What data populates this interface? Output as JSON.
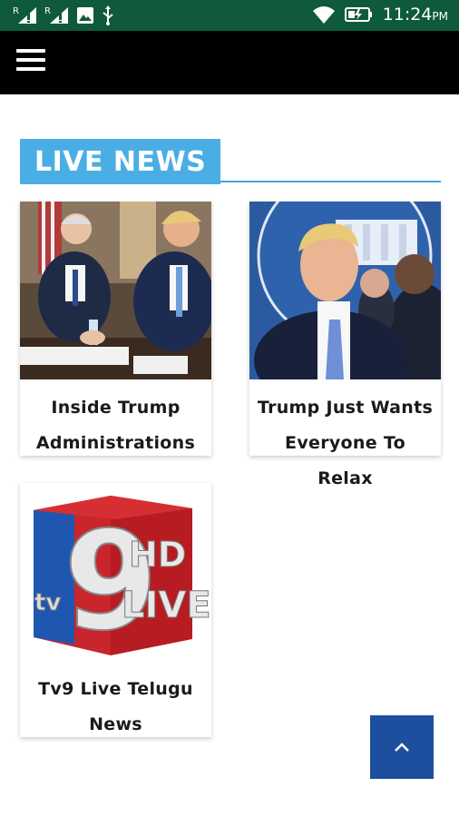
{
  "status_bar": {
    "sim1_label": "R",
    "sim2_label": "R",
    "time": "11:24",
    "ampm": "PM",
    "background_color": "#0f5a3c",
    "icons": [
      "signal-icon",
      "signal-icon",
      "image-icon",
      "usb-icon",
      "wifi-icon",
      "battery-charging-icon"
    ]
  },
  "app_bar": {
    "menu_icon": "hamburger-menu-icon",
    "background_color": "#000000"
  },
  "section": {
    "title": "LIVE NEWS",
    "accent_color": "#4aaee4"
  },
  "cards": [
    {
      "title": "Inside Trump Administrations",
      "image": "meeting-photo"
    },
    {
      "title": "Trump Just Wants Everyone To Relax",
      "image": "press-briefing-photo"
    },
    {
      "title": "Tv9 Live Telugu News",
      "image": "tv9-hd-live-logo",
      "logo_text": [
        "9",
        "HD",
        "LIVE",
        "tv"
      ]
    }
  ],
  "scroll_top_button": {
    "icon": "chevron-up-icon",
    "color": "#1d4f9e"
  }
}
